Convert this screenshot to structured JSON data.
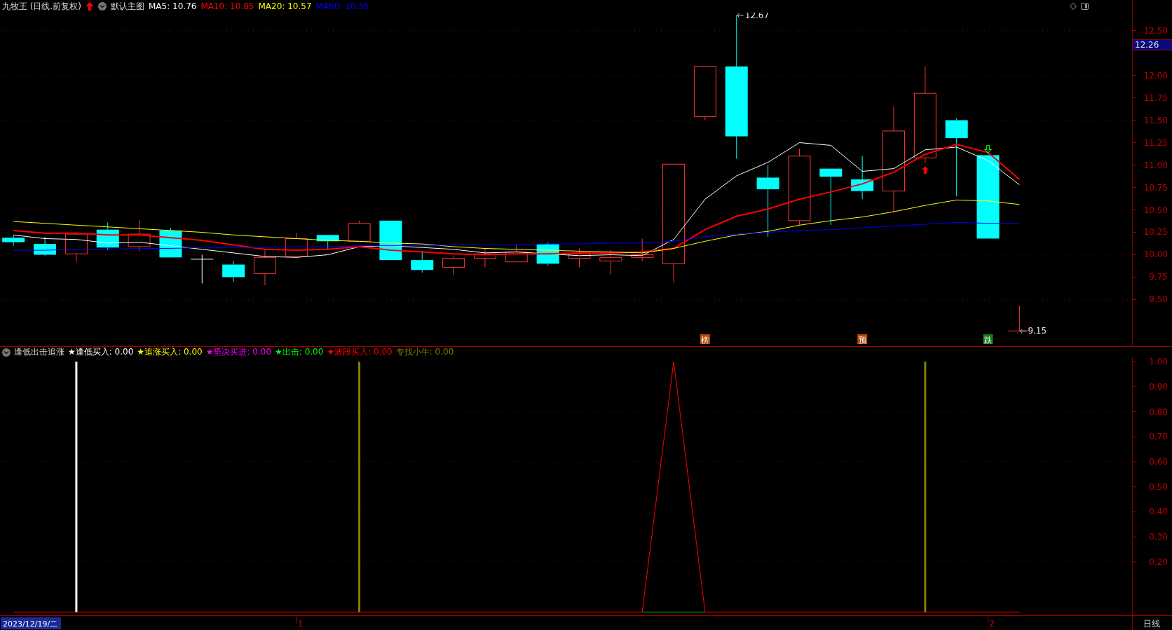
{
  "header": {
    "title": "九牧王 (日线.前复权)",
    "template": "默认主图",
    "ma": [
      {
        "label": "MA5: 10.76",
        "color": "#ffffff"
      },
      {
        "label": "MA10: 10.85",
        "color": "#ff0000"
      },
      {
        "label": "MA20: 10.57",
        "color": "#ffff00"
      },
      {
        "label": "MA60: 10.35",
        "color": "#0000ff"
      }
    ]
  },
  "price_chart": {
    "current_price": "12.26",
    "high_label": "12.67",
    "low_label": "9.15",
    "axis_labels": [
      "12.50",
      "12.00",
      "11.75",
      "11.50",
      "11.25",
      "11.00",
      "10.75",
      "10.50",
      "10.25",
      "10.00",
      "9.75",
      "9.50"
    ],
    "badges": [
      {
        "text": "榜",
        "color": "#b34a00"
      },
      {
        "text": "预",
        "color": "#b34a00"
      },
      {
        "text": "跌",
        "color": "#1a7a1a"
      }
    ]
  },
  "indicator": {
    "name": "逢低出击追涨",
    "items": [
      {
        "label": "★逢低买入: 0.00",
        "color": "#ffffff"
      },
      {
        "label": "★追涨买入: 0.00",
        "color": "#ffff00"
      },
      {
        "label": "★坚决买进: 0.00",
        "color": "#ff00ff"
      },
      {
        "label": "★出击: 0.00",
        "color": "#00ff00"
      },
      {
        "label": "★波段买入: 0.00",
        "color": "#ff0000"
      },
      {
        "label": "专找小牛: 0.00",
        "color": "#808000"
      }
    ],
    "axis_labels": [
      "1.00",
      "0.90",
      "0.80",
      "0.70",
      "0.60",
      "0.50",
      "0.40",
      "0.30",
      "0.20"
    ]
  },
  "bottom_bar": {
    "date": "2023/12/19/二",
    "axis_labels": [
      "1",
      "2"
    ],
    "period": "日线"
  }
}
